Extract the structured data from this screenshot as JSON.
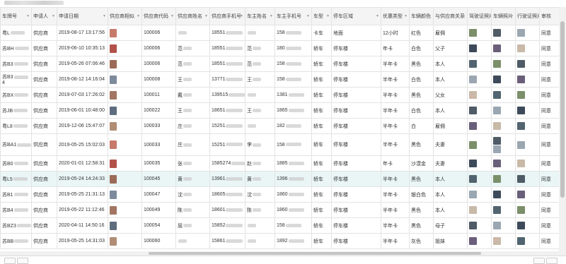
{
  "columns": [
    "车牌号",
    "申请人",
    "申请日期",
    "供应商相似",
    "供应商代码",
    "供应商姓名",
    "供应商手机号",
    "车主姓名",
    "车主手机号",
    "车型",
    "停车区域",
    "优惠类型",
    "车辆颜色",
    "与供应商关系",
    "驾驶证照片",
    "车辆照片",
    "行驶证照片",
    "审核"
  ],
  "rows": [
    {
      "plate": "粤L",
      "applicant": "供应商",
      "date": "2019-08-17 13:17:56",
      "code": "100006",
      "supplier_name": "",
      "supplier_phone": "18551",
      "owner_name": "",
      "owner_phone": "158",
      "vtype": "卡车",
      "area": "地面",
      "discount": "12小时",
      "color": "红色",
      "relation": "雇佣",
      "audit": "同意"
    },
    {
      "plate": "苏BH",
      "applicant": "供应商",
      "date": "2019-06-10 10:35:13",
      "code": "100006",
      "supplier_name": "范",
      "supplier_phone": "18551",
      "owner_name": "范",
      "owner_phone": "180",
      "vtype": "轿车",
      "area": "停车楼",
      "discount": "年卡",
      "color": "白色",
      "relation": "父子",
      "audit": "同意"
    },
    {
      "plate": "苏B3",
      "applicant": "供应商",
      "date": "2019-05-26 07:06:46",
      "code": "100006",
      "supplier_name": "范",
      "supplier_phone": "18551",
      "owner_name": "范",
      "owner_phone": "158",
      "vtype": "轿车",
      "area": "停车楼",
      "discount": "半年卡",
      "color": "黑色",
      "relation": "本人",
      "audit": "同意"
    },
    {
      "plate": "苏B3",
      "plate2": "4",
      "applicant": "供应商",
      "date": "2019-08-12 14:16:04",
      "code": "100008",
      "supplier_name": "王",
      "supplier_phone": "13771",
      "owner_name": "王",
      "owner_phone": "158",
      "vtype": "轿车",
      "area": "停车楼",
      "discount": "半年卡",
      "color": "白色",
      "relation": "本人",
      "audit": "同意"
    },
    {
      "plate": "苏BX",
      "applicant": "供应商",
      "date": "2019-07-03 17:26:02",
      "code": "100011",
      "supplier_name": "戴",
      "supplier_phone": "139515",
      "owner_name": "",
      "owner_phone": "1381",
      "vtype": "轿车",
      "area": "停车楼",
      "discount": "半年卡",
      "color": "黑色",
      "relation": "父女",
      "audit": "同意"
    },
    {
      "plate": "苏JB",
      "applicant": "供应商",
      "date": "2019-06-01 10:48:00",
      "code": "100022",
      "supplier_name": "王",
      "supplier_phone": "18651",
      "owner_name": "王",
      "owner_phone": "1865",
      "vtype": "轿车",
      "area": "停车楼",
      "discount": "半年卡",
      "color": "白色",
      "relation": "本人",
      "audit": "同意"
    },
    {
      "plate": "粤L8",
      "applicant": "供应商",
      "date": "2019-12-06 15:47:07",
      "code": "100033",
      "supplier_name": "庄",
      "supplier_phone": "15251",
      "owner_name": "",
      "owner_phone": "182",
      "vtype": "轿车",
      "area": "停车楼",
      "discount": "半年卡",
      "color": "白",
      "relation": "雇佣",
      "audit": "同意"
    },
    {
      "plate": "苏BA1",
      "applicant": "供应商",
      "date": "2019-05-25 15:02:03",
      "code": "100033",
      "supplier_name": "庄",
      "supplier_phone": "15251",
      "owner_name": "李",
      "owner_phone": "158",
      "vtype": "轿车",
      "area": "停车楼",
      "discount": "半年卡",
      "color": "黑色",
      "relation": "夫妻",
      "audit": "同意",
      "tall": true
    },
    {
      "plate": "苏B0",
      "applicant": "供应商",
      "date": "2020-01-01 12:58:31",
      "code": "100035",
      "supplier_name": "张",
      "supplier_phone": "1585274",
      "owner_name": "赵",
      "owner_phone": "1885",
      "vtype": "轿车",
      "area": "停车楼",
      "discount": "年卡",
      "color": "沙漠金",
      "relation": "夫妻",
      "audit": "同意"
    },
    {
      "plate": "粤L5",
      "applicant": "供应商",
      "date": "2019-05-24 14:24:33",
      "code": "100045",
      "supplier_name": "黄",
      "supplier_phone": "13961",
      "owner_name": "黄",
      "owner_phone": "1396",
      "vtype": "轿车",
      "area": "停车楼",
      "discount": "半年卡",
      "color": "黑色",
      "relation": "本人",
      "audit": "同意",
      "hl": true
    },
    {
      "plate": "苏B1",
      "applicant": "供应商",
      "date": "2019-05-25 21:31:13",
      "code": "100047",
      "supplier_name": "沈",
      "supplier_phone": "18605",
      "owner_name": "沈",
      "owner_phone": "1860",
      "vtype": "轿车",
      "area": "停车楼",
      "discount": "半年卡",
      "color": "银白色",
      "relation": "本人",
      "audit": "同意"
    },
    {
      "plate": "苏B4",
      "applicant": "供应商",
      "date": "2019-05-22 11:12:46",
      "code": "100049",
      "supplier_name": "陈",
      "supplier_phone": "18601",
      "owner_name": "陈",
      "owner_phone": "1860",
      "vtype": "轿车",
      "area": "停车楼",
      "discount": "半年卡",
      "color": "黑色",
      "relation": "本人",
      "audit": "同意"
    },
    {
      "plate": "苏BZ3",
      "applicant": "供应商",
      "date": "2020-04-11 14:50:16",
      "code": "100054",
      "supplier_name": "屈",
      "supplier_phone": "15852",
      "owner_name": "",
      "owner_phone": "158",
      "vtype": "轿车",
      "area": "停车楼",
      "discount": "半年卡",
      "color": "黑色",
      "relation": "母子",
      "audit": "同意"
    },
    {
      "plate": "苏BB",
      "applicant": "供应商",
      "date": "2019-05-25 14:31:03",
      "code": "100060",
      "supplier_name": "",
      "supplier_phone": "15861",
      "owner_name": "",
      "owner_phone": "1892",
      "vtype": "轿车",
      "area": "停车楼",
      "discount": "半年卡",
      "color": "灰色",
      "relation": "姐妹",
      "audit": "同意"
    }
  ],
  "colors": {
    "header_bg": "#f4f4f4",
    "border": "#e3e3e3",
    "highlight_row": "#eaf6f6",
    "avatar_palette": [
      "#c77a6a",
      "#b3524a",
      "#9c6b57",
      "#7d8a9c",
      "#a27662",
      "#5e6d7e",
      "#b08d74"
    ],
    "thumb_palette": [
      "#7b8f6a",
      "#4f5b66",
      "#9aa7b3",
      "#3d4a5a",
      "#6a5f7a",
      "#c9b9a8",
      "#51646f"
    ]
  },
  "icons": {
    "sort": "caret-down-icon"
  }
}
